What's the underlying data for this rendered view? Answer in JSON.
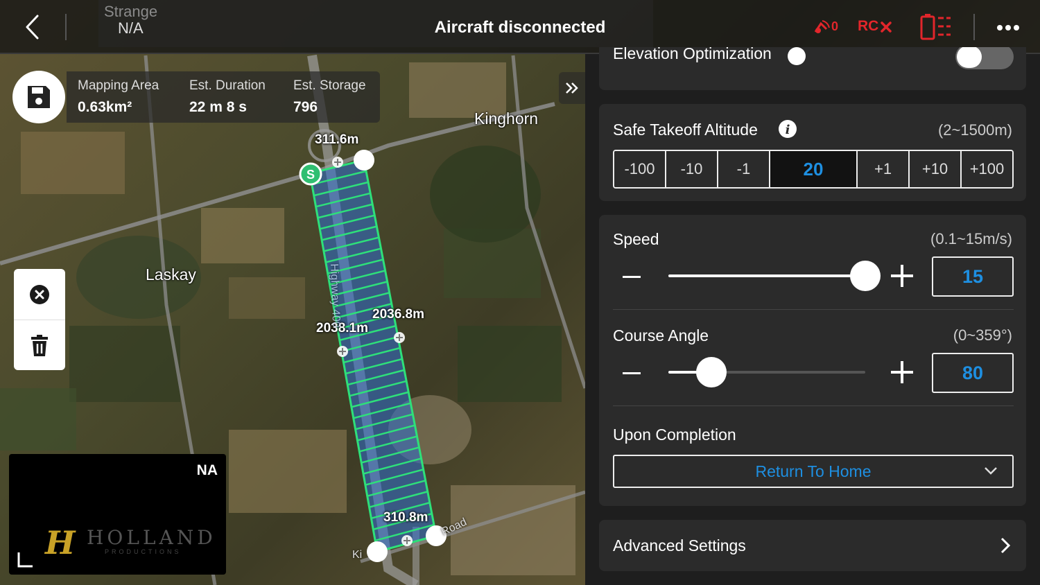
{
  "topbar": {
    "mission_name": "Strange",
    "mission_value": "N/A",
    "status_title": "Aircraft disconnected",
    "signal_count": "0",
    "rc_label": "RC",
    "icons": [
      "back-icon",
      "signal-lost-icon",
      "rc-disconnected-icon",
      "battery-icon",
      "more-icon"
    ]
  },
  "mapping": {
    "area_label": "Mapping Area",
    "area_value": "0.63km²",
    "duration_label": "Est. Duration",
    "duration_value": "22 m 8 s",
    "storage_label": "Est. Storage",
    "storage_value": "796"
  },
  "map": {
    "places": {
      "kinghorn": "Kinghorn",
      "laskay": "Laskay"
    },
    "distances": {
      "top": "311.6m",
      "right": "2036.8m",
      "left": "2038.1m",
      "bottom": "310.8m"
    },
    "start_marker": "S",
    "highway_label": "Highway 400",
    "road_label": "Road",
    "road_label_2": "Ki"
  },
  "preview": {
    "status": "NA",
    "logo_text": "HOLLAND",
    "logo_sub": "PRODUCTIONS",
    "logo_mark": "H"
  },
  "panel": {
    "elevation_label": "Elevation Optimization",
    "safe_takeoff": {
      "label": "Safe Takeoff Altitude",
      "range": "(2~1500m)",
      "steps": [
        "-100",
        "-10",
        "-1"
      ],
      "value": "20",
      "steps_up": [
        "+1",
        "+10",
        "+100"
      ]
    },
    "speed": {
      "label": "Speed",
      "range": "(0.1~15m/s)",
      "value": "15",
      "level": 1.0
    },
    "course_angle": {
      "label": "Course Angle",
      "range": "(0~359°)",
      "value": "80",
      "level": 0.22
    },
    "completion": {
      "label": "Upon Completion",
      "value": "Return To Home"
    },
    "advanced": {
      "label": "Advanced Settings"
    }
  },
  "colors": {
    "accent": "#1e8fe1",
    "alert": "#e2262b",
    "grid": "#2ee07a",
    "start": "#2fbf71"
  }
}
